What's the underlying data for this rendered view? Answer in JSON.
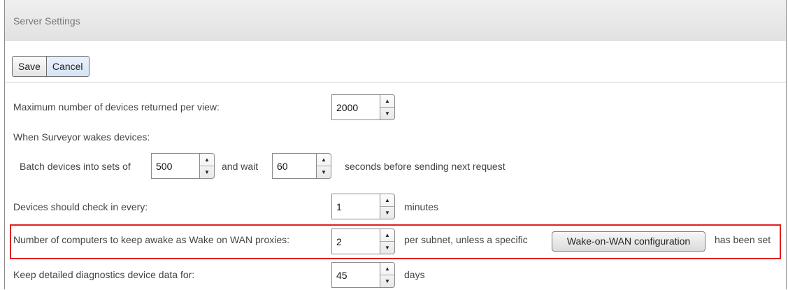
{
  "header": {
    "title": "Server Settings"
  },
  "toolbar": {
    "save_label": "Save",
    "cancel_label": "Cancel"
  },
  "settings": {
    "max_devices": {
      "label": "Maximum number of devices returned per view:",
      "value": "2000"
    },
    "wake": {
      "label": "When Surveyor wakes devices:",
      "batch_prefix": "Batch devices into sets of",
      "batch_value": "500",
      "wait_label": "and wait",
      "wait_value": "60",
      "wait_suffix": "seconds before sending next request"
    },
    "checkin": {
      "label": "Devices should check in every:",
      "value": "1",
      "suffix": "minutes"
    },
    "wan": {
      "label": "Number of computers to keep awake as Wake on WAN proxies:",
      "value": "2",
      "suffix": "per subnet, unless a specific",
      "button_label": "Wake-on-WAN configuration",
      "after_label": "has been set"
    },
    "diagnostics": {
      "label": "Keep detailed diagnostics device data for:",
      "value": "45",
      "suffix": "days"
    }
  },
  "icons": {
    "spinner_up": "▲",
    "spinner_down": "▼"
  }
}
